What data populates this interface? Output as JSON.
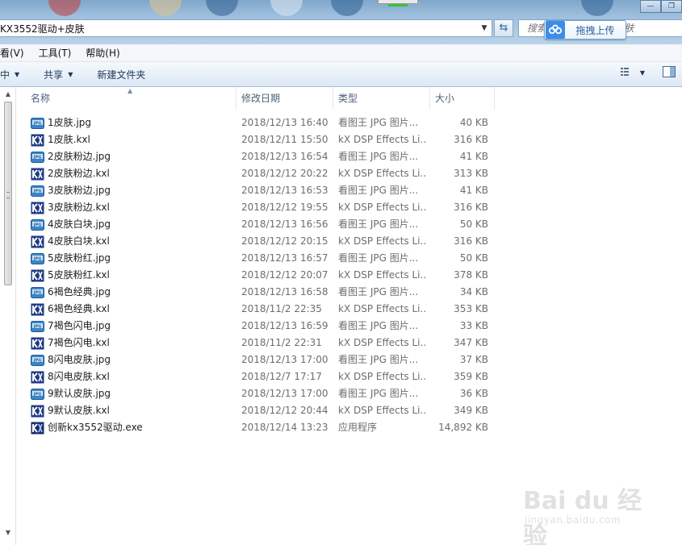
{
  "titlebar": {
    "address": "KX3552驱动+皮肤",
    "search_placeholder": "搜索 KX3552驱动+皮肤",
    "upload_label": "拖拽上传",
    "window_buttons": [
      "—",
      "❐"
    ]
  },
  "menubar": {
    "items": [
      "看(V)",
      "工具(T)",
      "帮助(H)"
    ]
  },
  "cmdbar": {
    "items": [
      "中",
      "共享",
      "新建文件夹"
    ]
  },
  "columns": {
    "name": "名称",
    "date": "修改日期",
    "type": "类型",
    "size": "大小"
  },
  "files": [
    {
      "name": "1皮肤.jpg",
      "date": "2018/12/13 16:40",
      "type": "看图王 JPG 图片...",
      "size": "40 KB",
      "icon": "jpg-icon"
    },
    {
      "name": "1皮肤.kxl",
      "date": "2018/12/11 15:50",
      "type": "kX DSP Effects Li...",
      "size": "316 KB",
      "icon": "kxl-icon"
    },
    {
      "name": "2皮肤粉边.jpg",
      "date": "2018/12/13 16:54",
      "type": "看图王 JPG 图片...",
      "size": "41 KB",
      "icon": "jpg-icon"
    },
    {
      "name": "2皮肤粉边.kxl",
      "date": "2018/12/12 20:22",
      "type": "kX DSP Effects Li...",
      "size": "313 KB",
      "icon": "kxl-icon"
    },
    {
      "name": "3皮肤粉边.jpg",
      "date": "2018/12/13 16:53",
      "type": "看图王 JPG 图片...",
      "size": "41 KB",
      "icon": "jpg-icon"
    },
    {
      "name": "3皮肤粉边.kxl",
      "date": "2018/12/12 19:55",
      "type": "kX DSP Effects Li...",
      "size": "316 KB",
      "icon": "kxl-icon"
    },
    {
      "name": "4皮肤白块.jpg",
      "date": "2018/12/13 16:56",
      "type": "看图王 JPG 图片...",
      "size": "50 KB",
      "icon": "jpg-icon"
    },
    {
      "name": "4皮肤白块.kxl",
      "date": "2018/12/12 20:15",
      "type": "kX DSP Effects Li...",
      "size": "316 KB",
      "icon": "kxl-icon"
    },
    {
      "name": "5皮肤粉红.jpg",
      "date": "2018/12/13 16:57",
      "type": "看图王 JPG 图片...",
      "size": "50 KB",
      "icon": "jpg-icon"
    },
    {
      "name": "5皮肤粉红.kxl",
      "date": "2018/12/12 20:07",
      "type": "kX DSP Effects Li...",
      "size": "378 KB",
      "icon": "kxl-icon"
    },
    {
      "name": "6褐色经典.jpg",
      "date": "2018/12/13 16:58",
      "type": "看图王 JPG 图片...",
      "size": "34 KB",
      "icon": "jpg-icon"
    },
    {
      "name": "6褐色经典.kxl",
      "date": "2018/11/2 22:35",
      "type": "kX DSP Effects Li...",
      "size": "353 KB",
      "icon": "kxl-icon"
    },
    {
      "name": "7褐色闪电.jpg",
      "date": "2018/12/13 16:59",
      "type": "看图王 JPG 图片...",
      "size": "33 KB",
      "icon": "jpg-icon"
    },
    {
      "name": "7褐色闪电.kxl",
      "date": "2018/11/2 22:31",
      "type": "kX DSP Effects Li...",
      "size": "347 KB",
      "icon": "kxl-icon"
    },
    {
      "name": "8闪电皮肤.jpg",
      "date": "2018/12/13 17:00",
      "type": "看图王 JPG 图片...",
      "size": "37 KB",
      "icon": "jpg-icon"
    },
    {
      "name": "8闪电皮肤.kxl",
      "date": "2018/12/7 17:17",
      "type": "kX DSP Effects Li...",
      "size": "359 KB",
      "icon": "kxl-icon"
    },
    {
      "name": "9默认皮肤.jpg",
      "date": "2018/12/13 17:00",
      "type": "看图王 JPG 图片...",
      "size": "36 KB",
      "icon": "jpg-icon"
    },
    {
      "name": "9默认皮肤.kxl",
      "date": "2018/12/12 20:44",
      "type": "kX DSP Effects Li...",
      "size": "349 KB",
      "icon": "kxl-icon"
    },
    {
      "name": "创新kx3552驱动.exe",
      "date": "2018/12/14 13:23",
      "type": "应用程序",
      "size": "14,892 KB",
      "icon": "exe-icon"
    }
  ],
  "watermark": {
    "brand": "Bai du 经验",
    "url": "jingyan.baidu.com"
  },
  "colors": {
    "accent": "#3c8de8",
    "jpg_icon": "#3a86c8",
    "kxl_icon": "#1f3b86"
  }
}
